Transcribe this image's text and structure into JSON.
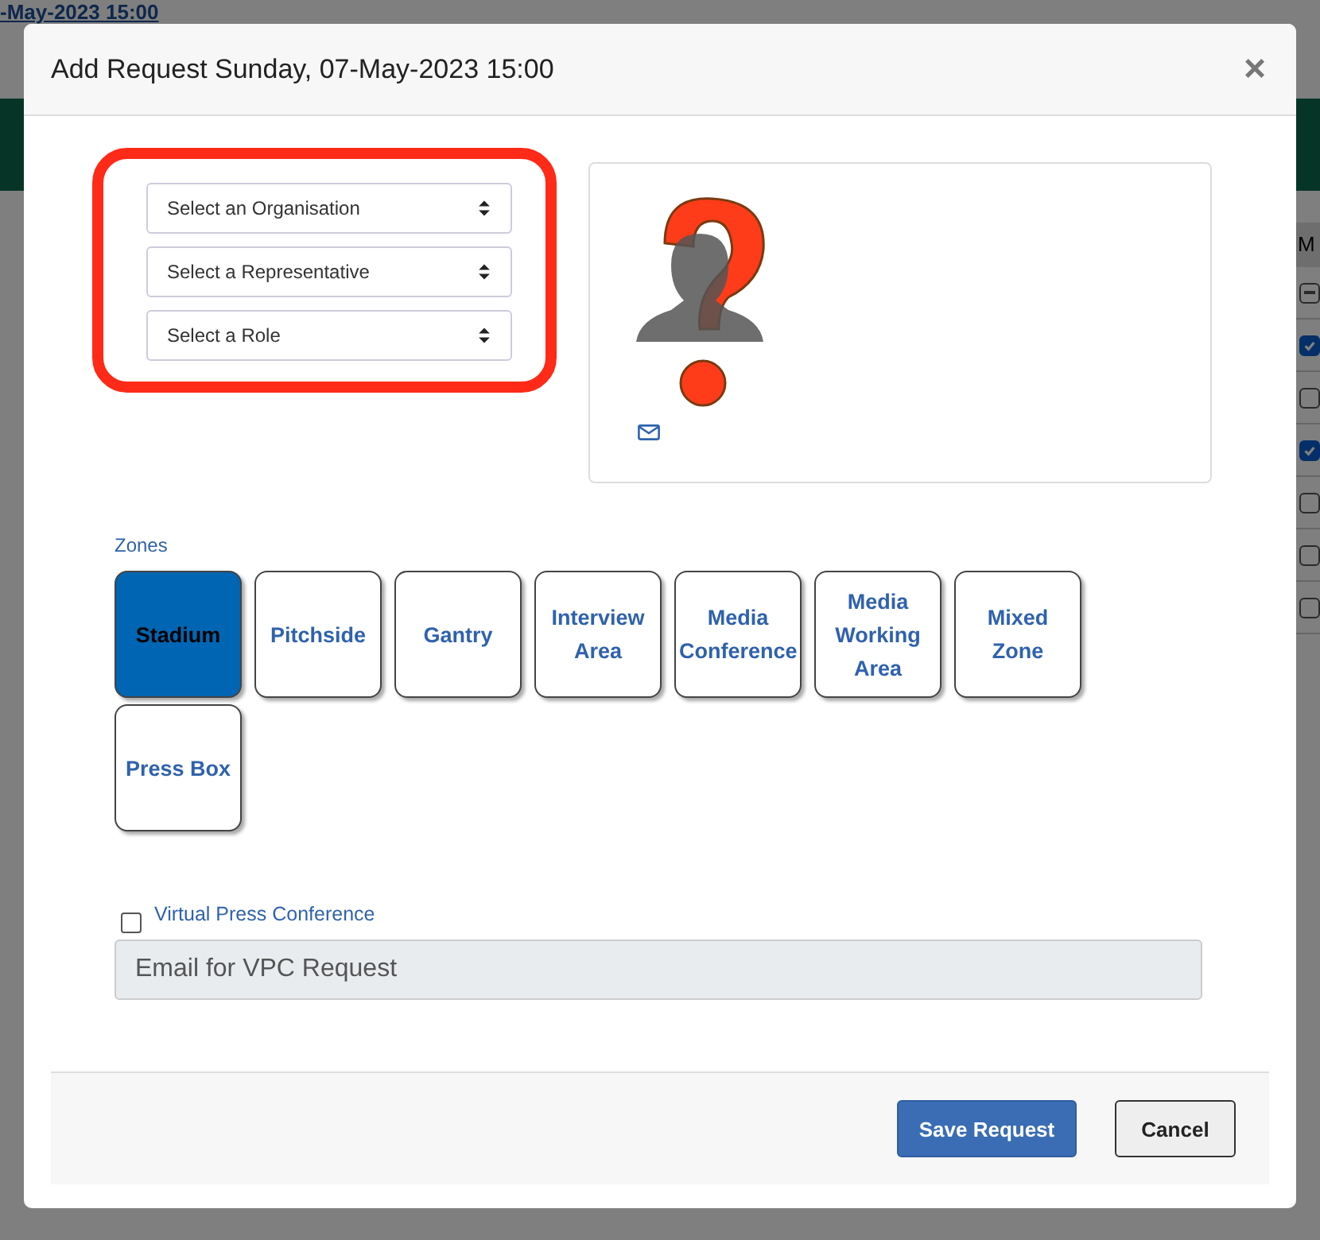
{
  "background": {
    "link": "-May-2023 15:00",
    "column_header": "M",
    "checkboxes": [
      {
        "kind": "indeterminate"
      },
      {
        "kind": "box",
        "checked": true
      },
      {
        "kind": "box",
        "checked": false
      },
      {
        "kind": "box",
        "checked": true
      },
      {
        "kind": "box",
        "checked": false
      },
      {
        "kind": "box",
        "checked": false
      },
      {
        "kind": "box",
        "checked": false
      }
    ]
  },
  "modal": {
    "title": "Add Request Sunday, 07-May-2023 15:00",
    "close": "×",
    "selects": [
      {
        "placeholder": "Select an Organisation"
      },
      {
        "placeholder": "Select a Representative"
      },
      {
        "placeholder": "Select a Role"
      }
    ],
    "zones_label": "Zones",
    "zones": [
      {
        "label": "Stadium",
        "selected": true
      },
      {
        "label": "Pitchside",
        "selected": false
      },
      {
        "label": "Gantry",
        "selected": false
      },
      {
        "label": "Interview Area",
        "selected": false
      },
      {
        "label": "Media Conference",
        "selected": false
      },
      {
        "label": "Media Working Area",
        "selected": false
      },
      {
        "label": "Mixed Zone",
        "selected": false
      },
      {
        "label": "Press Box",
        "selected": false
      }
    ],
    "vpc": {
      "label": "Virtual Press Conference",
      "checked": false
    },
    "email": {
      "placeholder": "Email for VPC Request"
    },
    "buttons": [
      {
        "label": "Save Request",
        "kind": "primary"
      },
      {
        "label": "Cancel",
        "kind": "secondary"
      }
    ]
  }
}
